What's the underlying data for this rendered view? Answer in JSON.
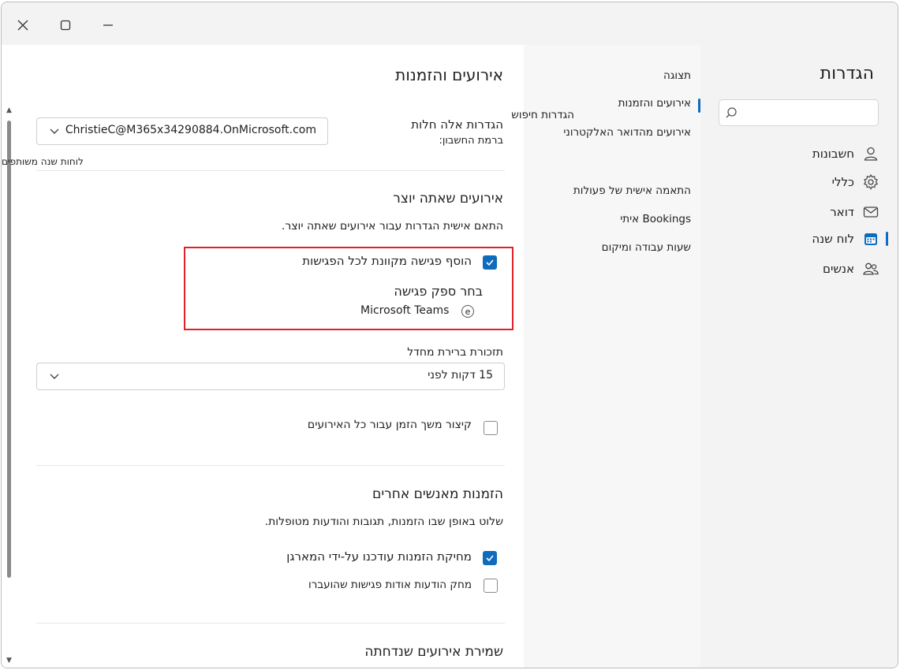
{
  "window": {
    "close_glyph": "✕",
    "maximize_glyph": "▢",
    "minimize_glyph": "—"
  },
  "side": {
    "title": "הגדרות",
    "search_placeholder": "",
    "items": [
      {
        "label": "חשבונות",
        "icon": "person-icon"
      },
      {
        "label": "כללי",
        "icon": "gear-icon"
      },
      {
        "label": "דואר",
        "icon": "mail-icon"
      },
      {
        "label": "לוח שנה",
        "icon": "calendar-icon",
        "active": true
      },
      {
        "label": "אנשים",
        "icon": "people-icon"
      }
    ]
  },
  "nav": {
    "items": [
      {
        "label": "תצוגה"
      },
      {
        "label": "אירועים והזמנות",
        "active": true
      },
      {
        "label": "הגדרות חיפוש"
      },
      {
        "label": "אירועים מהדואר האלקטרוני"
      },
      {
        "label": "התאמה אישית של פעולות"
      },
      {
        "label": "Bookings איתי"
      },
      {
        "label": "שעות עבודה ומיקום"
      }
    ]
  },
  "content": {
    "title": "אירועים והזמנות",
    "account_label": "הגדרות אלה חלות",
    "account_sublabel": "ברמת החשבון:",
    "account_value": "ChristieC@M365x34290884.OnMicrosoft.com",
    "shared_calendars_note": "לוחות שנה משותפים",
    "section_created": {
      "heading": "אירועים שאתה יוצר",
      "description": "התאם אישית הגדרות עבור אירועים שאתה יוצר.",
      "online_meeting_checkbox": "הוסף פגישה מקוונת לכל הפגישות",
      "online_meeting_checked": true,
      "provider_label": "בחר ספק פגישה",
      "provider_value": "Microsoft Teams",
      "provider_radio_glyph": "e"
    },
    "reminder": {
      "label": "תזכורת ברירת מחדל",
      "value": "15 דקות לפני"
    },
    "shorten_checkbox": "קיצור משך הזמן עבור כל האירועים",
    "shorten_checked": false,
    "section_invites": {
      "heading": "הזמנות מאנשים אחרים",
      "description": "שלוט באופן שבו הזמנות, תגובות והודעות מטופלות.",
      "delete_updated": "מחיקת הזמנות עודכנו על-ידי המארגן",
      "delete_updated_checked": true,
      "delete_past": "מחק הודעות אודות פגישות שהועברו",
      "delete_past_checked": false
    },
    "section_declined": {
      "heading": "שמירת אירועים שנדחתה"
    }
  },
  "colors": {
    "accent": "#0f6cbd",
    "highlight": "#e1202a"
  }
}
